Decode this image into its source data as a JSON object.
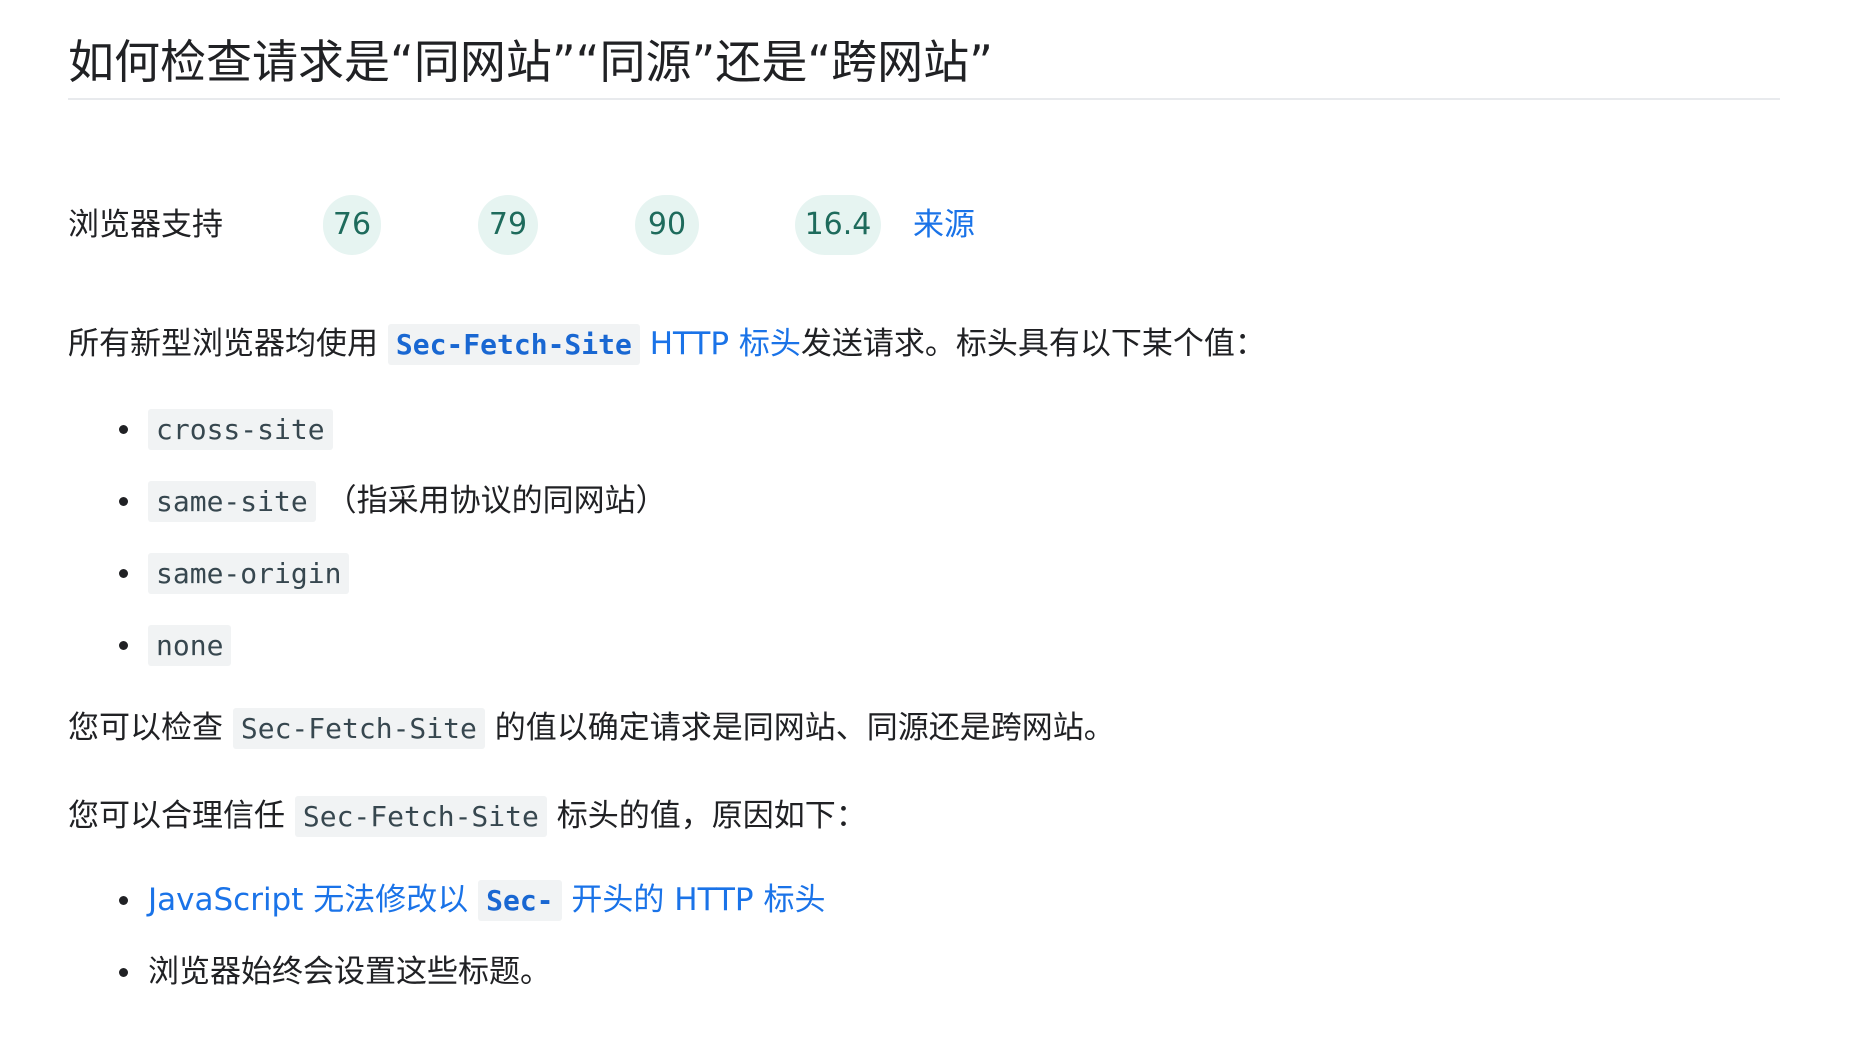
{
  "title": "如何检查请求是“同网站”“同源”还是“跨网站”",
  "browser_support": {
    "label": "浏览器支持",
    "versions": [
      "76",
      "79",
      "90",
      "16.4"
    ],
    "source_link": "来源"
  },
  "intro": {
    "before": "所有新型浏览器均使用",
    "code": "Sec-Fetch-Site",
    "link": "HTTP 标头",
    "after": "发送请求。标头具有以下某个值："
  },
  "values_list": [
    {
      "code": "cross-site",
      "note": ""
    },
    {
      "code": "same-site",
      "note": "（指采用协议的同网站）"
    },
    {
      "code": "same-origin",
      "note": ""
    },
    {
      "code": "none",
      "note": ""
    }
  ],
  "check_para": {
    "before": "您可以检查",
    "code": "Sec-Fetch-Site",
    "after": "的值以确定请求是同网站、同源还是跨网站。"
  },
  "trust_para": {
    "before": "您可以合理信任",
    "code": "Sec-Fetch-Site",
    "after": "标头的值，原因如下："
  },
  "reasons_list": [
    {
      "link_before": "JavaScript 无法修改以",
      "code": "Sec-",
      "link_after": "开头的 HTTP 标头"
    },
    {
      "text": "浏览器始终会设置这些标题。"
    }
  ]
}
